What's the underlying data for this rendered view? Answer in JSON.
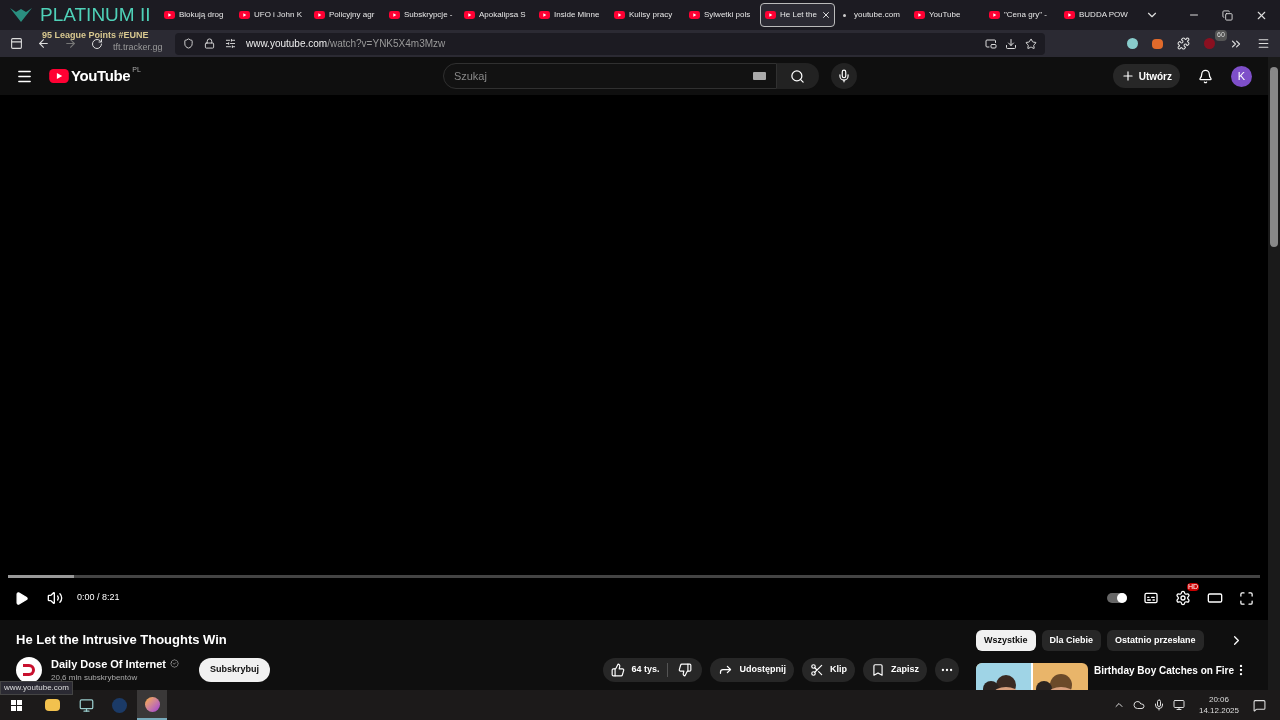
{
  "overlay": {
    "rank": "PLATINUM II",
    "points": "95 League Points #EUNE",
    "site": "tft.tracker.gg"
  },
  "tabs": [
    {
      "title": "Blokują drog",
      "kind": "video",
      "selected": false
    },
    {
      "title": "UFO i John K",
      "kind": "video",
      "selected": false
    },
    {
      "title": "Policyjny agr",
      "kind": "video",
      "selected": false
    },
    {
      "title": "Subskrypcje -",
      "kind": "video",
      "selected": false
    },
    {
      "title": "Apokalipsa S",
      "kind": "video",
      "selected": false
    },
    {
      "title": "Inside Minne",
      "kind": "video",
      "selected": false
    },
    {
      "title": "Kulisy pracy",
      "kind": "video",
      "selected": false
    },
    {
      "title": "Sylwetki pols",
      "kind": "video",
      "selected": false
    },
    {
      "title": "He Let the",
      "kind": "video",
      "selected": true
    },
    {
      "title": "youtube.com",
      "kind": "loading",
      "selected": false
    },
    {
      "title": "YouTube",
      "kind": "video",
      "selected": false
    },
    {
      "title": "\"Cena gry\" -",
      "kind": "video",
      "selected": false
    },
    {
      "title": "BUDDA POW",
      "kind": "video",
      "selected": false
    }
  ],
  "address": {
    "host": "www.youtube.com",
    "path": "/watch?v=YNK5X4m3Mzw"
  },
  "extensions_badge": "60",
  "youtube": {
    "logo": "YouTube",
    "region": "PL",
    "search_placeholder": "Szukaj",
    "create": "Utwórz",
    "avatar": "K"
  },
  "player": {
    "level": 0.053,
    "time": "0:00 / 8:21",
    "quality_badge": "HD",
    "autoplay": true
  },
  "video": {
    "title": "He Let the Intrusive Thoughts Win",
    "channel": "Daily Dose Of Internet",
    "subscribers": "20,6 mln subskrybentów",
    "subscribe": "Subskrybuj",
    "likes": "64 tys.",
    "share": "Udostępnij",
    "clip": "Klip",
    "save": "Zapisz"
  },
  "chips": [
    {
      "label": "Wszystkie",
      "selected": true
    },
    {
      "label": "Dla Ciebie",
      "selected": false
    },
    {
      "label": "Ostatnio przesłane",
      "selected": false
    }
  ],
  "recommended": [
    {
      "title": "Birthday Boy Catches on Fire"
    }
  ],
  "status_url": "www.youtube.com",
  "clock": {
    "time": "20:06",
    "date": "14.12.2025"
  }
}
